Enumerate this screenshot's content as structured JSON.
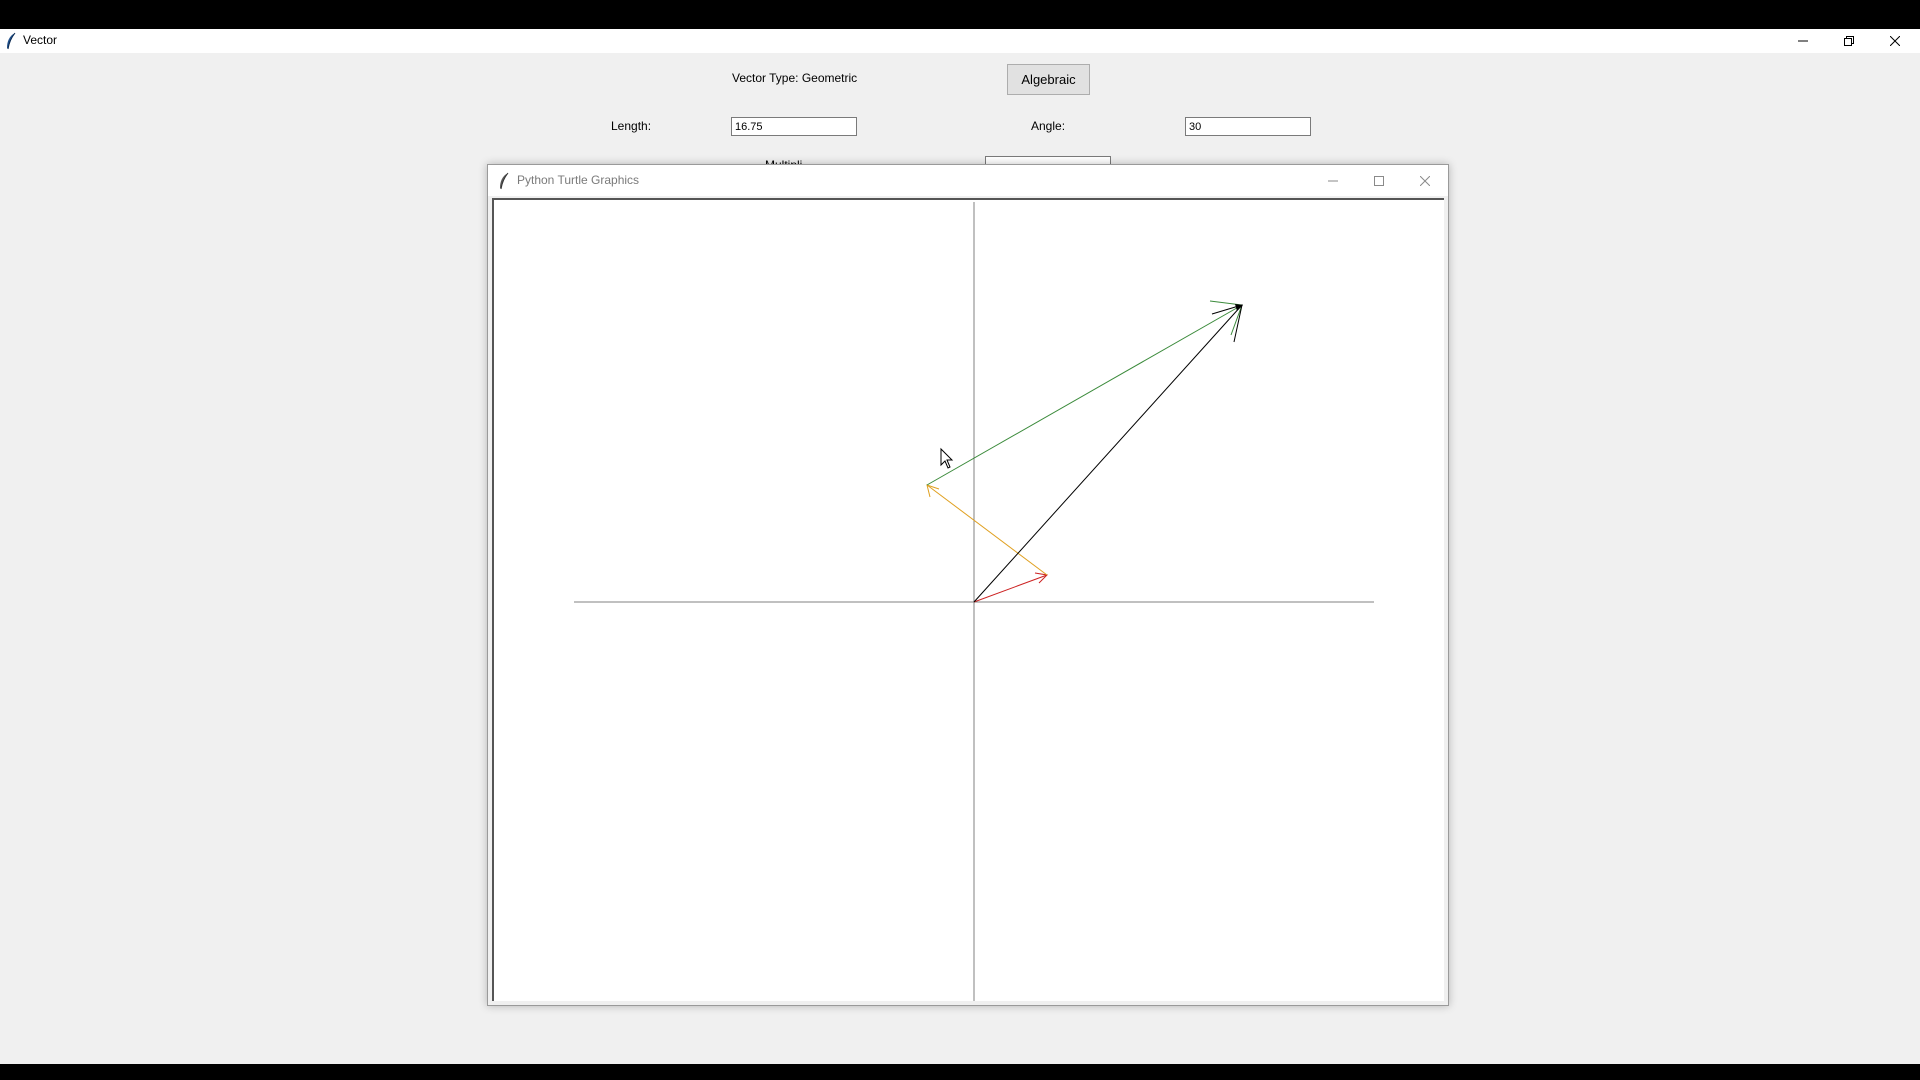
{
  "main_window": {
    "title": "Vector"
  },
  "controls": {
    "vector_type_label": "Vector Type: Geometric",
    "toggle_button_label": "Algebraic",
    "length_label": "Length:",
    "length_value": "16.75",
    "angle_label": "Angle:",
    "angle_value": "30",
    "partial_label": "Multipli"
  },
  "turtle_window": {
    "title": "Python Turtle Graphics"
  },
  "vectors": [
    {
      "name": "red",
      "color": "#cc2222"
    },
    {
      "name": "yellow",
      "color": "#e0a020"
    },
    {
      "name": "green",
      "color": "#3a8a3a"
    },
    {
      "name": "resultant",
      "color": "#000000"
    }
  ],
  "colors": {
    "axis": "#808080",
    "titlebar": "#ffffff",
    "window_bg": "#f0f0f0"
  },
  "icons": {
    "app": "feather-icon",
    "minimize": "minimize-icon",
    "restore": "restore-icon",
    "maximize": "maximize-icon",
    "close": "close-icon",
    "cursor": "mouse-pointer-icon"
  }
}
